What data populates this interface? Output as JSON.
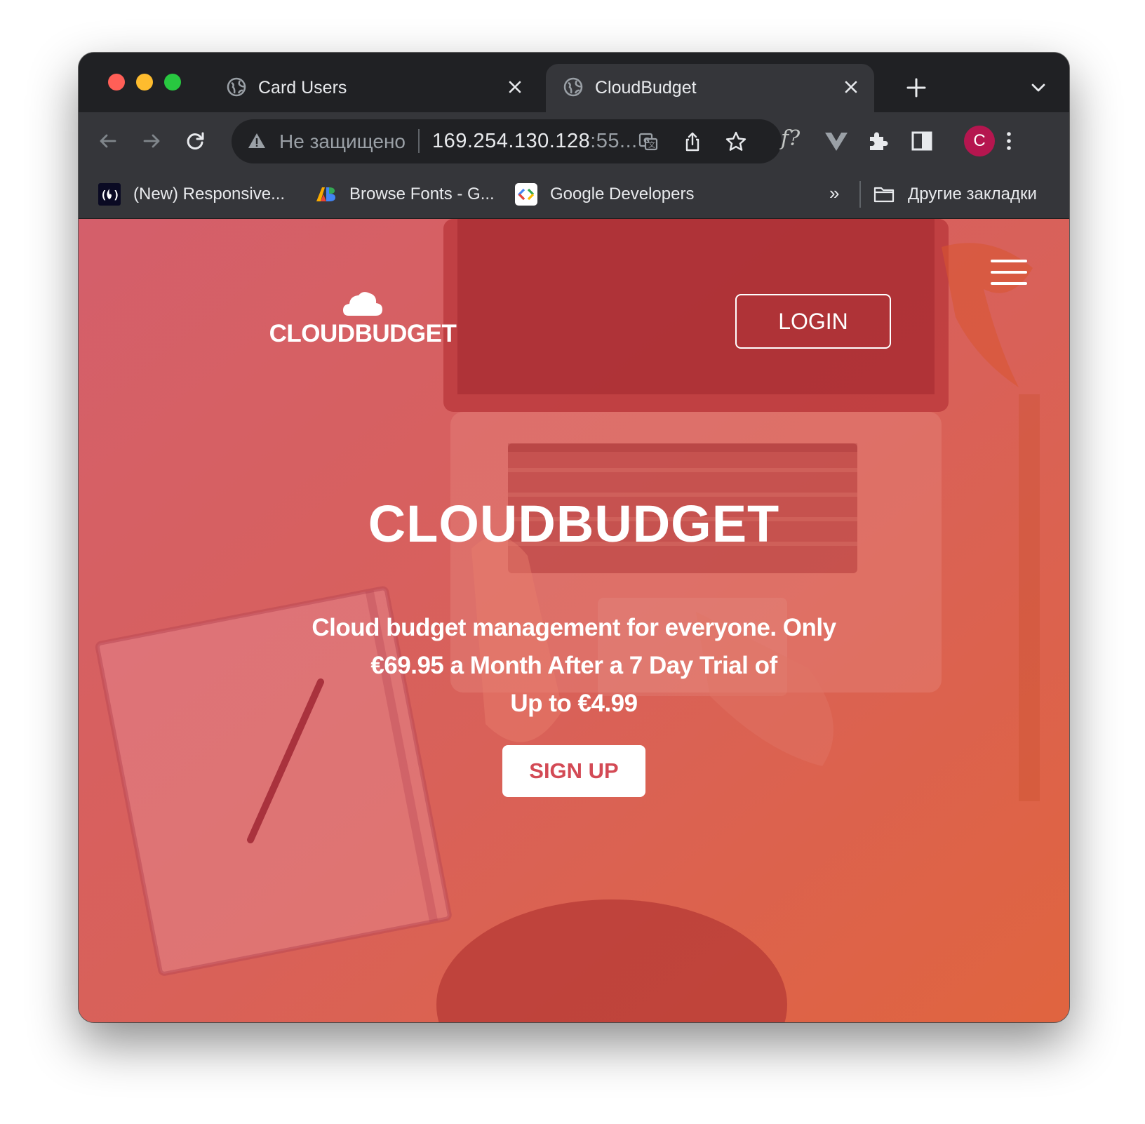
{
  "browser": {
    "tabs": [
      {
        "title": "Card Users",
        "active": false
      },
      {
        "title": "CloudBudget",
        "active": true
      }
    ],
    "address_bar": {
      "security_label": "Не защищено",
      "url_main": "169.254.130.128",
      "url_dim": ":55..."
    },
    "profile_initial": "C",
    "extension_fx_label": "f?",
    "bookmarks": [
      {
        "label": "(New) Responsive...",
        "icon": "freecodecamp-icon"
      },
      {
        "label": "Browse Fonts - G...",
        "icon": "google-fonts-icon"
      },
      {
        "label": "Google Developers",
        "icon": "google-developers-icon"
      }
    ],
    "bookmarks_overflow": "»",
    "other_bookmarks": "Другие закладки"
  },
  "site": {
    "logo_text": "CLOUDBUDGET",
    "login_label": "LOGIN",
    "hero_title": "CLOUDBUDGET",
    "hero_line1": "Cloud budget management for everyone. Only",
    "hero_line2": "€69.95 a Month After a 7 Day Trial of",
    "hero_line3": "Up to €4.99",
    "signup_label": "SIGN UP"
  },
  "colors": {
    "hero_overlay_start": "#d45a6a",
    "hero_overlay_end": "#e0643f",
    "signup_text": "#d34a55",
    "browser_dark": "#202124",
    "browser_toolbar": "#35363a",
    "avatar": "#b5164f"
  }
}
